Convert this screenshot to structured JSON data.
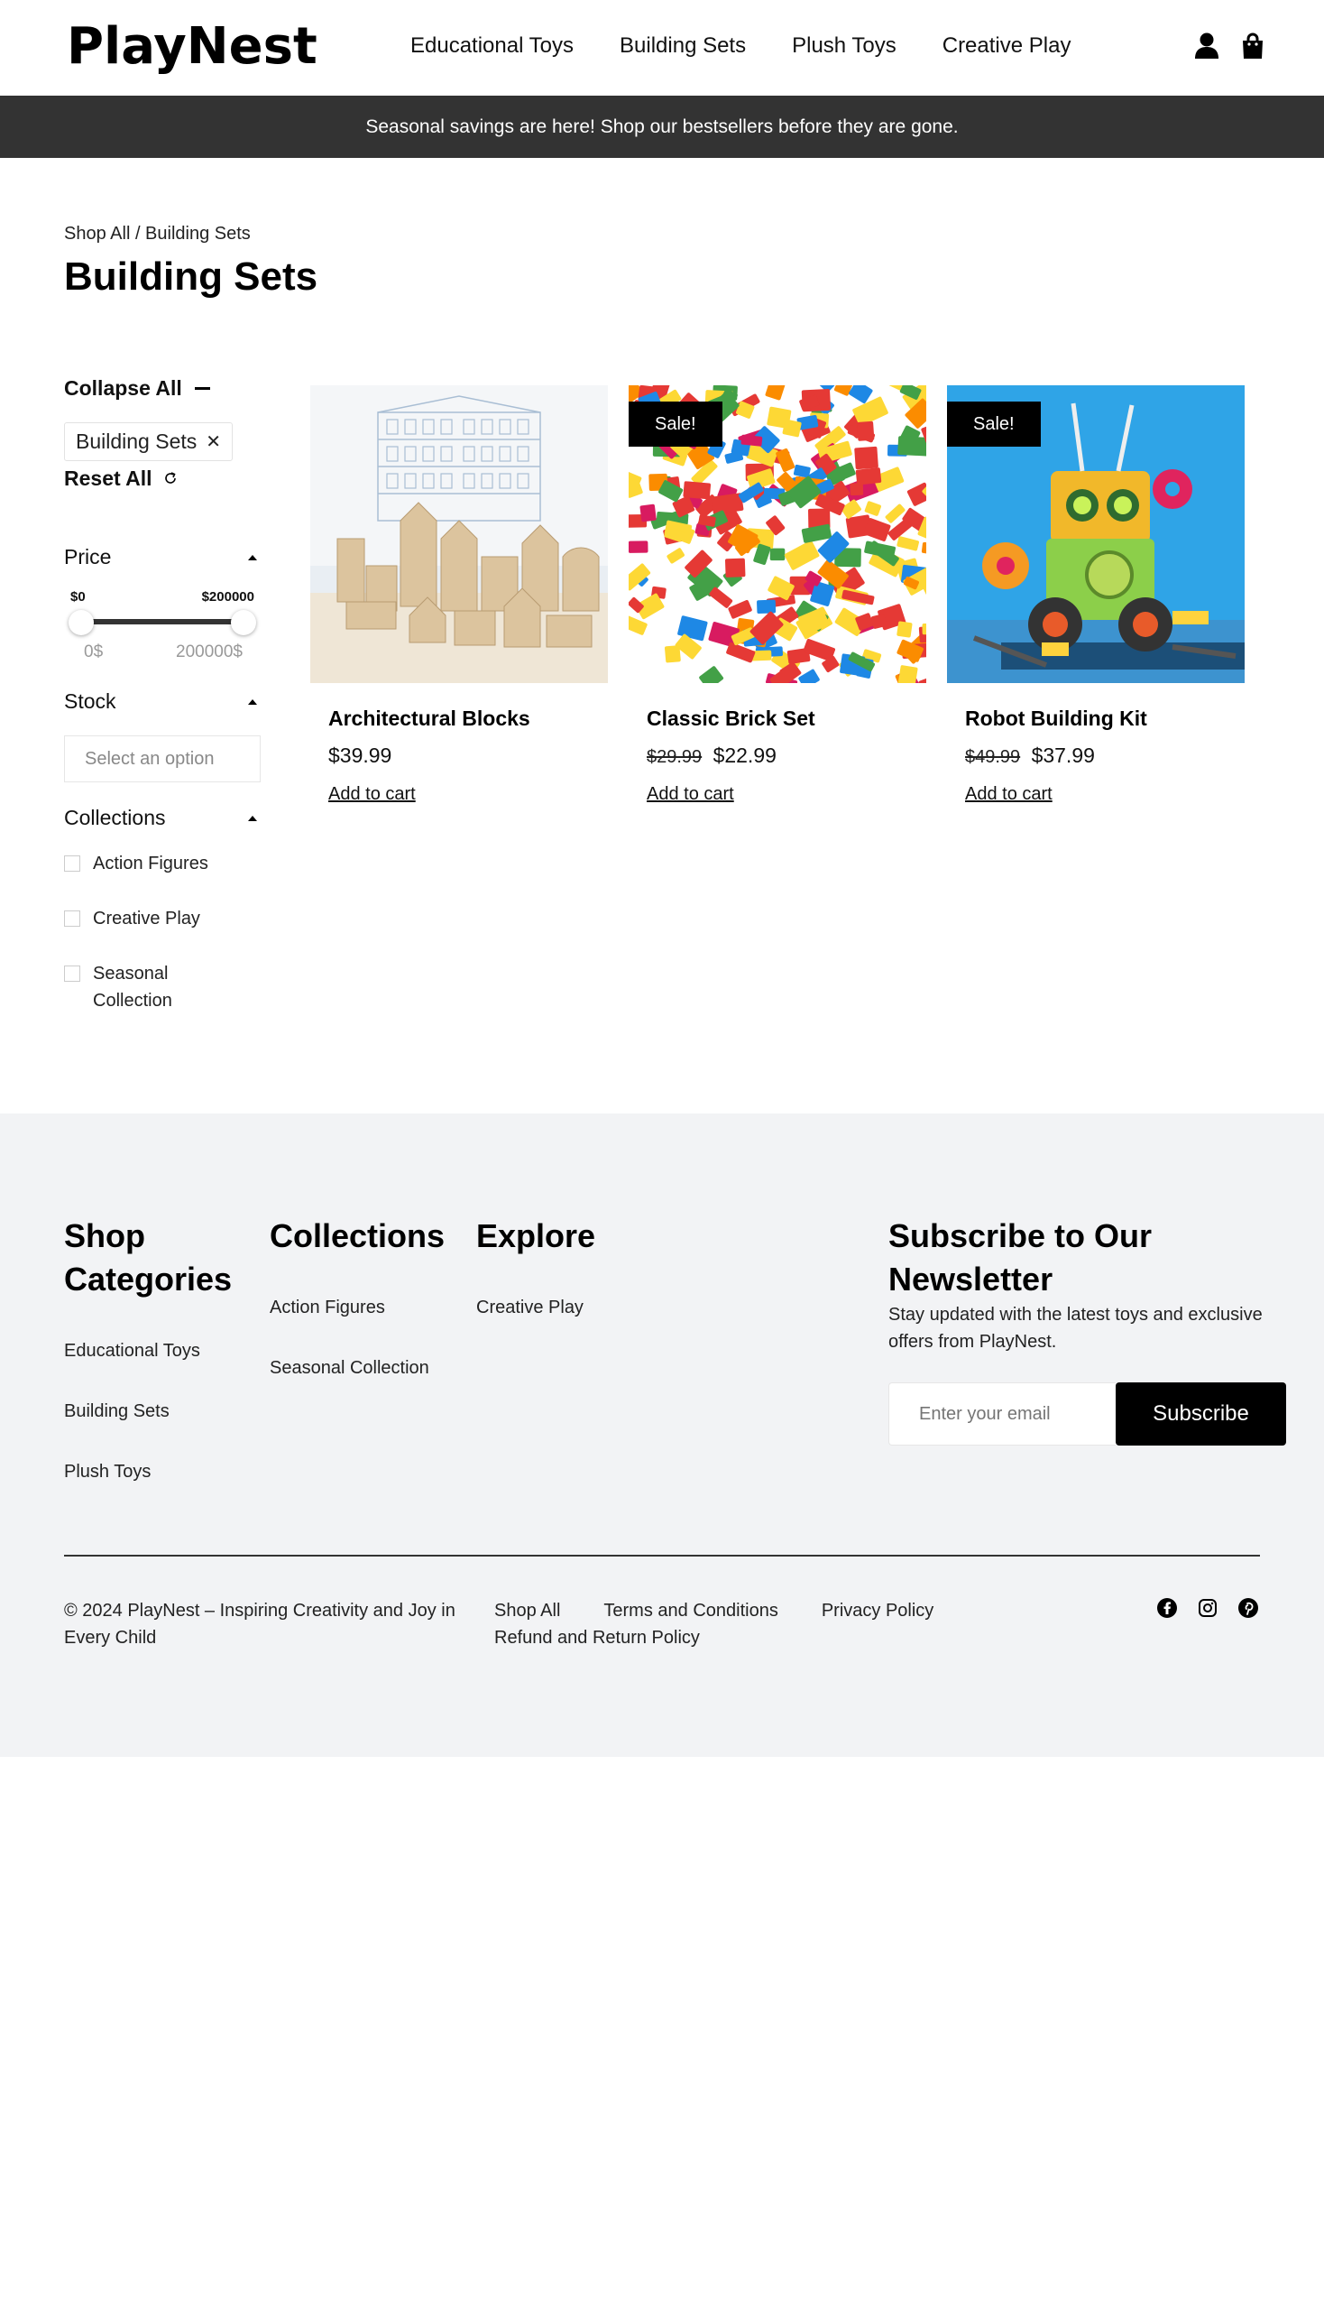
{
  "header": {
    "logo": "PlayNest",
    "nav": [
      "Educational Toys",
      "Building Sets",
      "Plush Toys",
      "Creative Play"
    ],
    "icons": [
      "user-icon",
      "shopping-bag-icon"
    ]
  },
  "banner": "Seasonal savings are here! Shop our bestsellers before they are gone.",
  "breadcrumb": "Shop All / Building Sets",
  "page_title": "Building Sets",
  "sidebar": {
    "collapse_all": "Collapse All",
    "active_filter": "Building Sets",
    "reset_all": "Reset All",
    "price": {
      "label": "Price",
      "min_label": "$0",
      "max_label": "$200000",
      "min_value": "0$",
      "max_value": "200000$"
    },
    "stock": {
      "label": "Stock",
      "placeholder": "Select an option"
    },
    "collections": {
      "label": "Collections",
      "options": [
        "Action Figures",
        "Creative Play",
        "Seasonal Collection"
      ]
    }
  },
  "products": [
    {
      "name": "Architectural Blocks",
      "price": "$39.99",
      "old_price": "",
      "sale_badge": "",
      "add_to_cart": "Add to cart"
    },
    {
      "name": "Classic Brick Set",
      "price": "$22.99",
      "old_price": "$29.99",
      "sale_badge": "Sale!",
      "add_to_cart": "Add to cart"
    },
    {
      "name": "Robot Building Kit",
      "price": "$37.99",
      "old_price": "$49.99",
      "sale_badge": "Sale!",
      "add_to_cart": "Add to cart"
    }
  ],
  "footer": {
    "shop_categories": {
      "title": "Shop Categories",
      "items": [
        "Educational Toys",
        "Building Sets",
        "Plush Toys"
      ]
    },
    "collections": {
      "title": "Collections",
      "items": [
        "Action Figures",
        "Seasonal Collection"
      ]
    },
    "explore": {
      "title": "Explore",
      "items": [
        "Creative Play"
      ]
    },
    "newsletter": {
      "title": "Subscribe to Our Newsletter",
      "text": "Stay updated with the latest toys and exclusive offers from PlayNest.",
      "placeholder": "Enter your email",
      "button": "Subscribe"
    },
    "copyright": "© 2024 PlayNest – Inspiring Creativity and Joy in Every Child",
    "legal_links": [
      "Shop All",
      "Terms and Conditions",
      "Privacy Policy",
      "Refund and Return Policy"
    ],
    "social": [
      "facebook-icon",
      "instagram-icon",
      "pinterest-icon"
    ]
  },
  "colors": {
    "banner_bg": "#333333",
    "footer_bg": "#f2f3f5",
    "accent": "#000000"
  }
}
